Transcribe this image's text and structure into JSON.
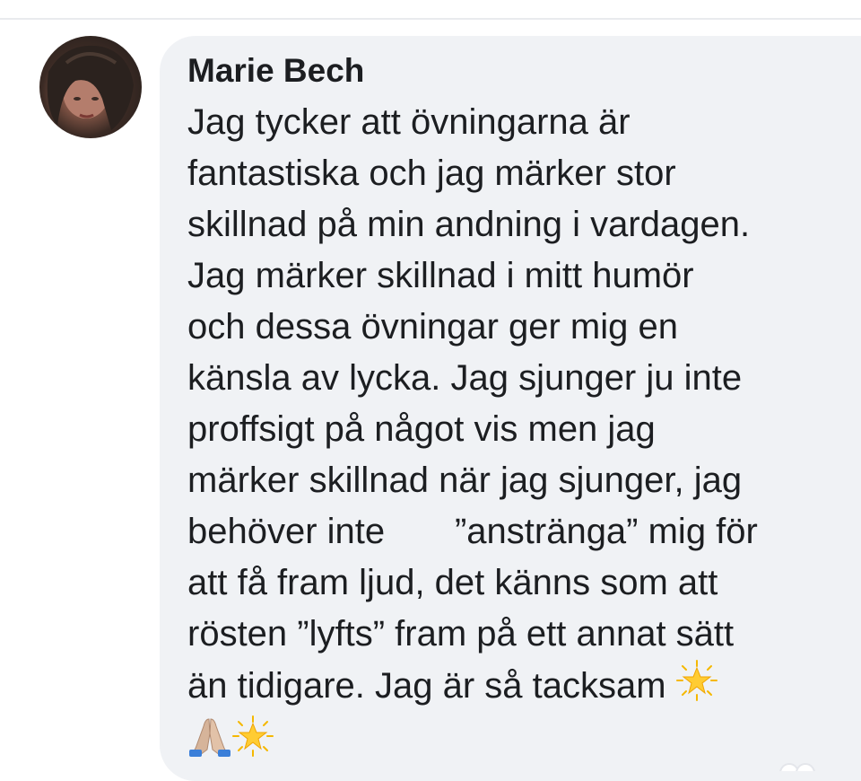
{
  "comment": {
    "author": "Marie Bech",
    "lines": [
      "Jag tycker att övningarna är",
      "fantastiska och jag märker stor",
      "skillnad på min andning i vardagen.",
      "Jag märker skillnad i mitt humör",
      "och dessa övningar ger mig en",
      "känsla av lycka. Jag sjunger ju inte",
      "proffsigt på något vis men jag",
      "märker skillnad när jag sjunger, jag",
      "behöver inte       ”anstränga” mig för",
      "att få fram ljud, det känns som att",
      "rösten ”lyfts” fram på ett annat sätt",
      "än tidigare. Jag är så tacksam "
    ],
    "emojis": {
      "after_last_line": "glowing-star-icon",
      "final_line": [
        "folded-hands-icon",
        "glowing-star-icon"
      ]
    }
  },
  "colors": {
    "bubble": "#f0f2f5",
    "text": "#1c1e21",
    "divider": "#e9ebee"
  }
}
